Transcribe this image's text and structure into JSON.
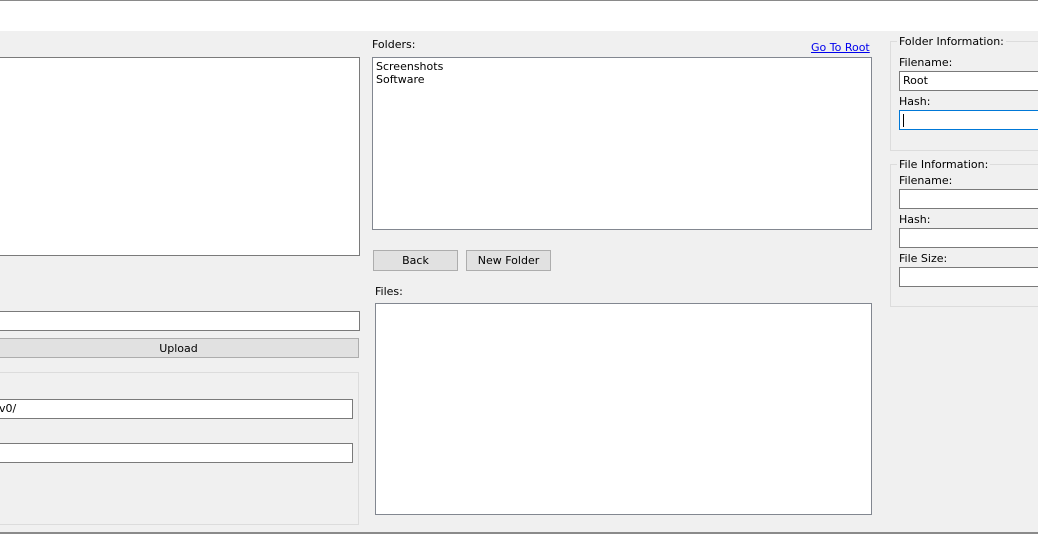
{
  "window": {},
  "left_panel": {
    "upload_path_value": "",
    "upload_button": "Upload",
    "field1_value": "v0/",
    "field2_value": ""
  },
  "folders": {
    "label": "Folders:",
    "go_to_root": "Go To Root",
    "items": [
      "Screenshots",
      "Software"
    ],
    "back_button": "Back",
    "new_folder_button": "New Folder"
  },
  "files": {
    "label": "Files:",
    "items": []
  },
  "folder_info": {
    "title": "Folder Information:",
    "filename_label": "Filename:",
    "filename_value": "Root",
    "hash_label": "Hash:",
    "hash_value": ""
  },
  "file_info": {
    "title": "File Information:",
    "filename_label": "Filename:",
    "filename_value": "",
    "hash_label": "Hash:",
    "hash_value": "",
    "size_label": "File Size:",
    "size_value": ""
  }
}
